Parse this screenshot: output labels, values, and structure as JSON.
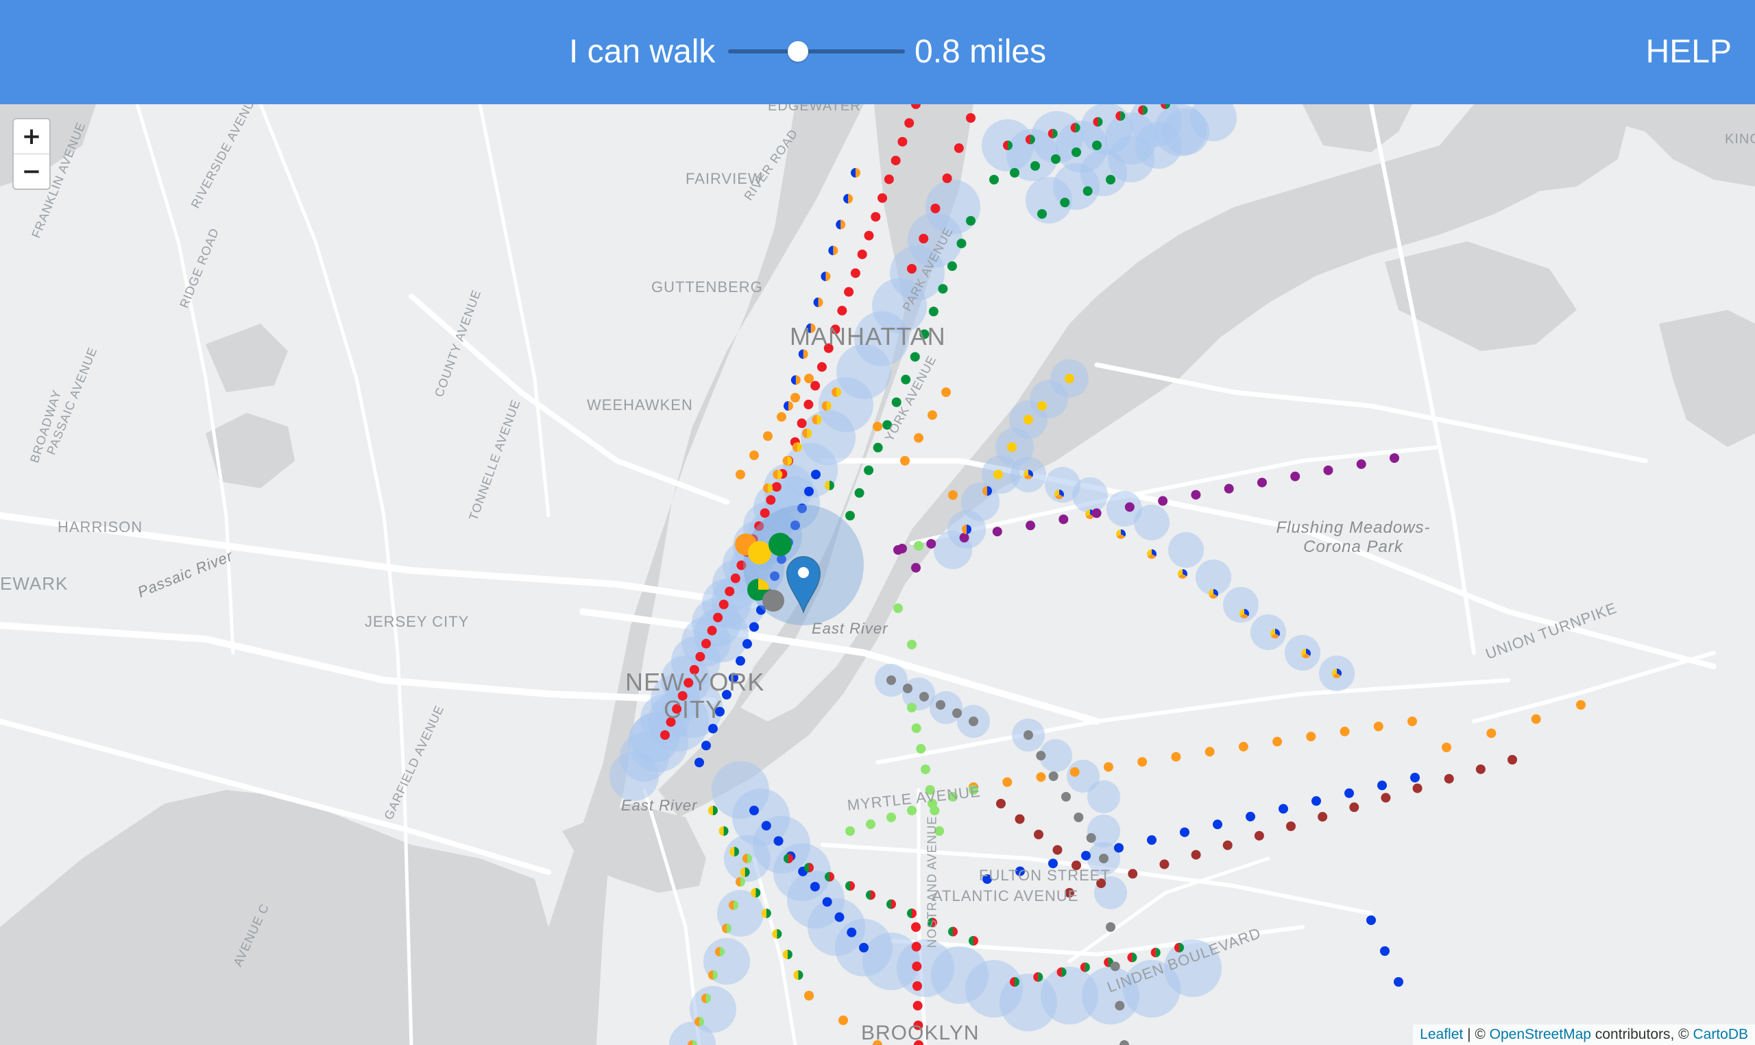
{
  "header": {
    "walk_label": "I can walk",
    "distance": "0.8 miles",
    "help_label": "HELP",
    "slider_value_miles": 0.8
  },
  "zoom": {
    "in_label": "+",
    "out_label": "−"
  },
  "attribution": {
    "leaflet": "Leaflet",
    "sep": " | © ",
    "osm": "OpenStreetMap",
    "contrib": " contributors, © ",
    "carto": "CartoDB"
  },
  "labels": {
    "manhattan": "MANHATTAN",
    "new_york": "NEW YORK",
    "city": "CITY",
    "brooklyn": "BROOKLYN",
    "jersey_city": "JERSEY CITY",
    "weehawken": "WEEHAWKEN",
    "guttenberg": "GUTTENBERG",
    "fairview": "FAIRVIEW",
    "harrison": "HARRISON",
    "newark": "EWARK",
    "east_river_1": "East River",
    "east_river_2": "East River",
    "passaic_river": "Passaic River",
    "flushing_park": "Flushing Meadows-Corona Park",
    "union_turnpike": "UNION TURNPIKE",
    "myrtle_avenue": "MYRTLE AVENUE",
    "fulton_street": "FULTON STREET",
    "atlantic_avenue": "ATLANTIC AVENUE",
    "linden_boulevard": "LINDEN BOULEVARD",
    "park_avenue": "PARK AVENUE",
    "york_avenue": "YORK AVENUE",
    "river_road": "RIVER ROAD",
    "riverside_avenue": "RIVERSIDE AVENUE",
    "ridge_road": "RIDGE ROAD",
    "county_avenue": "COUNTY AVENUE",
    "tonnelle_avenue": "TONNELLE AVENUE",
    "passaic_avenue": "PASSAIC AVENUE",
    "broadway": "BROADWAY",
    "garfield_avenue": "GARFIELD AVENUE",
    "avenue_c": "AVENUE C",
    "nostrand_avenue": "NOSTRAND AVENUE",
    "franklin_avenue": "FRANKLIN AVENUE",
    "kings": "KING",
    "edgewater": "EDGEWATER"
  },
  "colors": {
    "red": "#ee1c25",
    "blue": "#0039e6",
    "green": "#00933c",
    "yellow": "#fccc0a",
    "orange": "#ff9a1e",
    "purple": "#8b1b8f",
    "gray": "#808183",
    "lightgreen": "#8ee46e",
    "brown": "#a2312f",
    "halo": "#a9c7ef"
  }
}
